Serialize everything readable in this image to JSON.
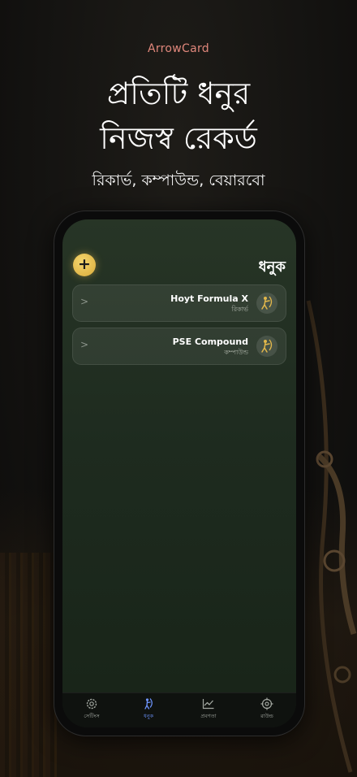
{
  "brand": "ArrowCard",
  "hero": {
    "title_line1": "প্রতিটি ধনুর",
    "title_line2": "নিজস্ব রেকর্ড",
    "subtitle": "রিকার্ভ, কম্পাউন্ড, বেয়ারবো"
  },
  "app": {
    "title": "ধনুক",
    "add_label": "+",
    "bows": [
      {
        "name": "Hoyt Formula X",
        "type": "রিকার্ভ",
        "icon": "archer-icon"
      },
      {
        "name": "PSE Compound",
        "type": "কম্পাউন্ড",
        "icon": "archer-icon"
      }
    ],
    "tabs": [
      {
        "label": "সেটিংস",
        "icon": "gear-icon",
        "active": false
      },
      {
        "label": "ধনুক",
        "icon": "archer-icon",
        "active": true
      },
      {
        "label": "প্রবণতা",
        "icon": "trend-chart-icon",
        "active": false
      },
      {
        "label": "রাউন্ড",
        "icon": "target-icon",
        "active": false
      }
    ]
  },
  "colors": {
    "brand": "#e0877b",
    "accent_gold": "#e2b74a",
    "active_tab": "#6e95ff",
    "screen_bg": "#1f2c20"
  }
}
